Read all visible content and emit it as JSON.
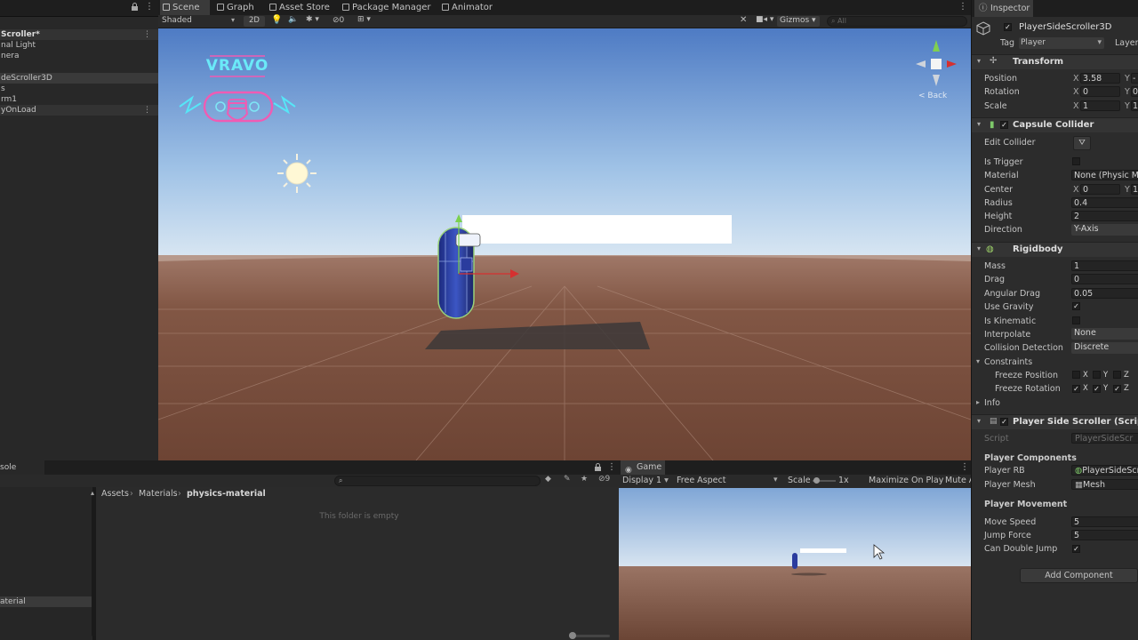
{
  "hierarchy": {
    "items": [
      "Scroller*",
      "nal Light",
      "nera",
      "deScroller3D",
      "s",
      "rm1",
      "yOnLoad"
    ]
  },
  "scene": {
    "tabs": [
      "Scene",
      "Graph",
      "Asset Store",
      "Package Manager",
      "Animator"
    ],
    "shading": "Shaded",
    "mode2d": "2D",
    "fx_count": "0",
    "gizmos": "Gizmos",
    "search_placeholder": "All",
    "back": "< Back",
    "logo_text": "VRAVO"
  },
  "project": {
    "tab": "sole",
    "crumb": [
      "Assets",
      "Materials",
      "physics-material"
    ],
    "empty": "This folder is empty",
    "left_item": "aterial",
    "count": "9"
  },
  "game": {
    "tab": "Game",
    "display": "Display 1",
    "aspect": "Free Aspect",
    "scale_label": "Scale",
    "scale_value": "1x",
    "maximize": "Maximize On Play",
    "mute": "Mute A"
  },
  "inspector": {
    "tab": "Inspector",
    "object_name": "PlayerSideScroller3D",
    "tag_label": "Tag",
    "tag_value": "Player",
    "layer_label": "Layer",
    "transform": {
      "title": "Transform",
      "position": "Position",
      "pos_x": "3.58",
      "pos_y": "-",
      "rotation": "Rotation",
      "rot_x": "0",
      "rot_y": "0",
      "scale": "Scale",
      "scl_x": "1",
      "scl_y": "1"
    },
    "capsule": {
      "title": "Capsule Collider",
      "edit": "Edit Collider",
      "is_trigger": "Is Trigger",
      "material": "Material",
      "material_value": "None (Physic Ma",
      "center": "Center",
      "center_x": "0",
      "center_y": "1",
      "radius": "Radius",
      "radius_value": "0.4",
      "height": "Height",
      "height_value": "2",
      "direction": "Direction",
      "direction_value": "Y-Axis"
    },
    "rigidbody": {
      "title": "Rigidbody",
      "mass": "Mass",
      "mass_value": "1",
      "drag": "Drag",
      "drag_value": "0",
      "angular": "Angular Drag",
      "angular_value": "0.05",
      "gravity": "Use Gravity",
      "kinematic": "Is Kinematic",
      "interpolate": "Interpolate",
      "interpolate_value": "None",
      "collision": "Collision Detection",
      "collision_value": "Discrete",
      "constraints": "Constraints",
      "freeze_pos": "Freeze Position",
      "freeze_rot": "Freeze Rotation",
      "info": "Info"
    },
    "script": {
      "title": "Player Side Scroller (Script)",
      "script_label": "Script",
      "script_value": "PlayerSideScr",
      "components": "Player Components",
      "rb": "Player RB",
      "rb_value": "PlayerSideScr",
      "mesh": "Player Mesh",
      "mesh_value": "Mesh",
      "movement": "Player Movement",
      "speed": "Move Speed",
      "speed_value": "5",
      "jump": "Jump Force",
      "jump_value": "5",
      "double": "Can Double Jump"
    },
    "add_component": "Add Component"
  }
}
